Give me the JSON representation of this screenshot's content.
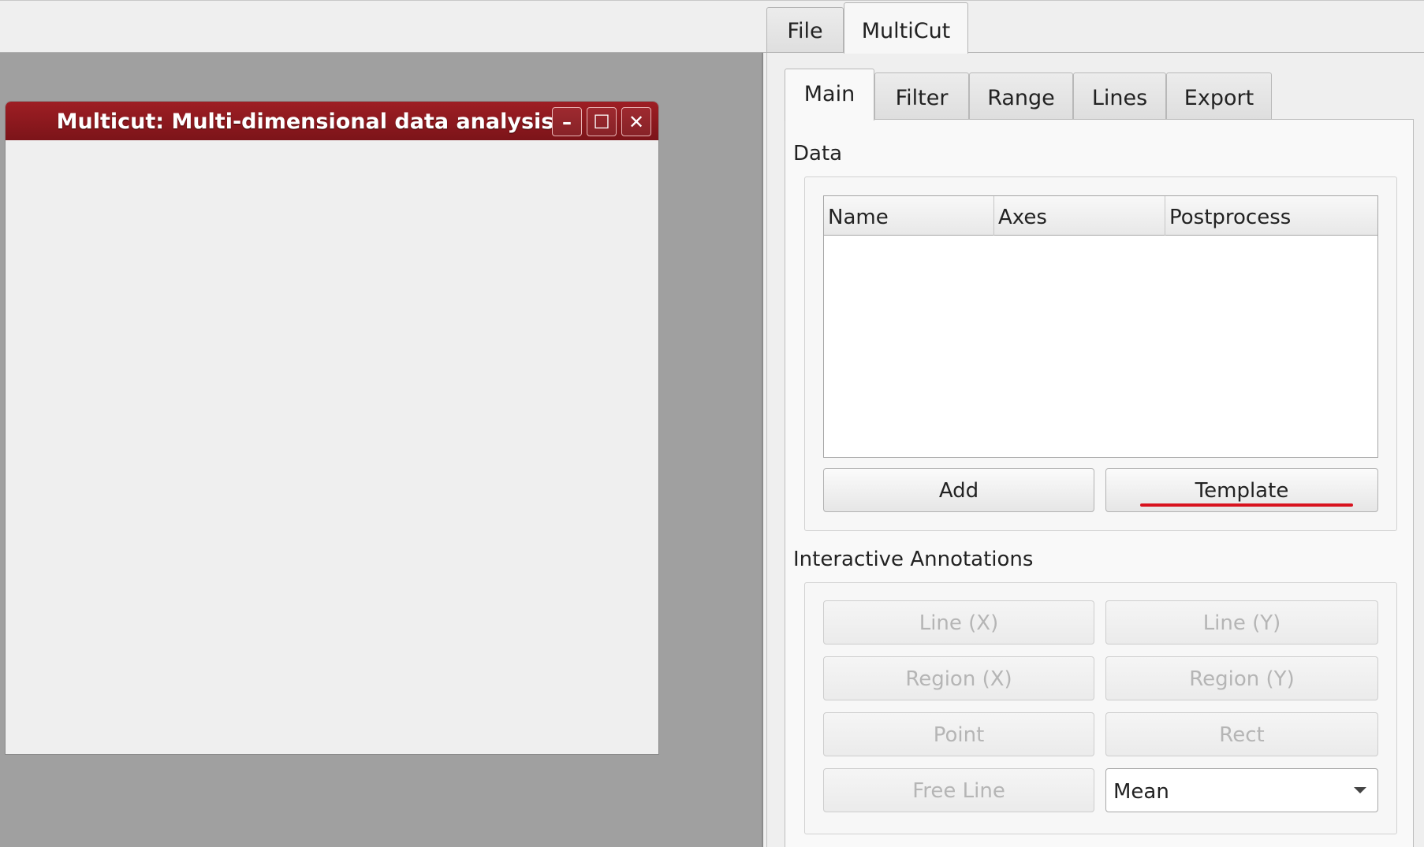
{
  "top_tabs": [
    {
      "label": "File"
    },
    {
      "label": "MultiCut"
    }
  ],
  "subwindow": {
    "title": "Multicut: Multi-dimensional data analysis",
    "buttons": {
      "minimize": "–",
      "maximize": "☐",
      "close": "✕"
    }
  },
  "panel_tabs": [
    {
      "label": "Main"
    },
    {
      "label": "Filter"
    },
    {
      "label": "Range"
    },
    {
      "label": "Lines"
    },
    {
      "label": "Export"
    }
  ],
  "data_section": {
    "label": "Data",
    "columns": [
      "Name",
      "Axes",
      "Postprocess"
    ],
    "add_label": "Add",
    "template_label": "Template"
  },
  "annotations_section": {
    "label": "Interactive Annotations",
    "line_x": "Line (X)",
    "line_y": "Line (Y)",
    "region_x": "Region (X)",
    "region_y": "Region (Y)",
    "point": "Point",
    "rect": "Rect",
    "free_line": "Free Line",
    "mode_value": "Mean"
  },
  "colors": {
    "title_bar": "#8c181d",
    "mdi_background": "#a0a0a0",
    "highlight": "#d8121e"
  }
}
